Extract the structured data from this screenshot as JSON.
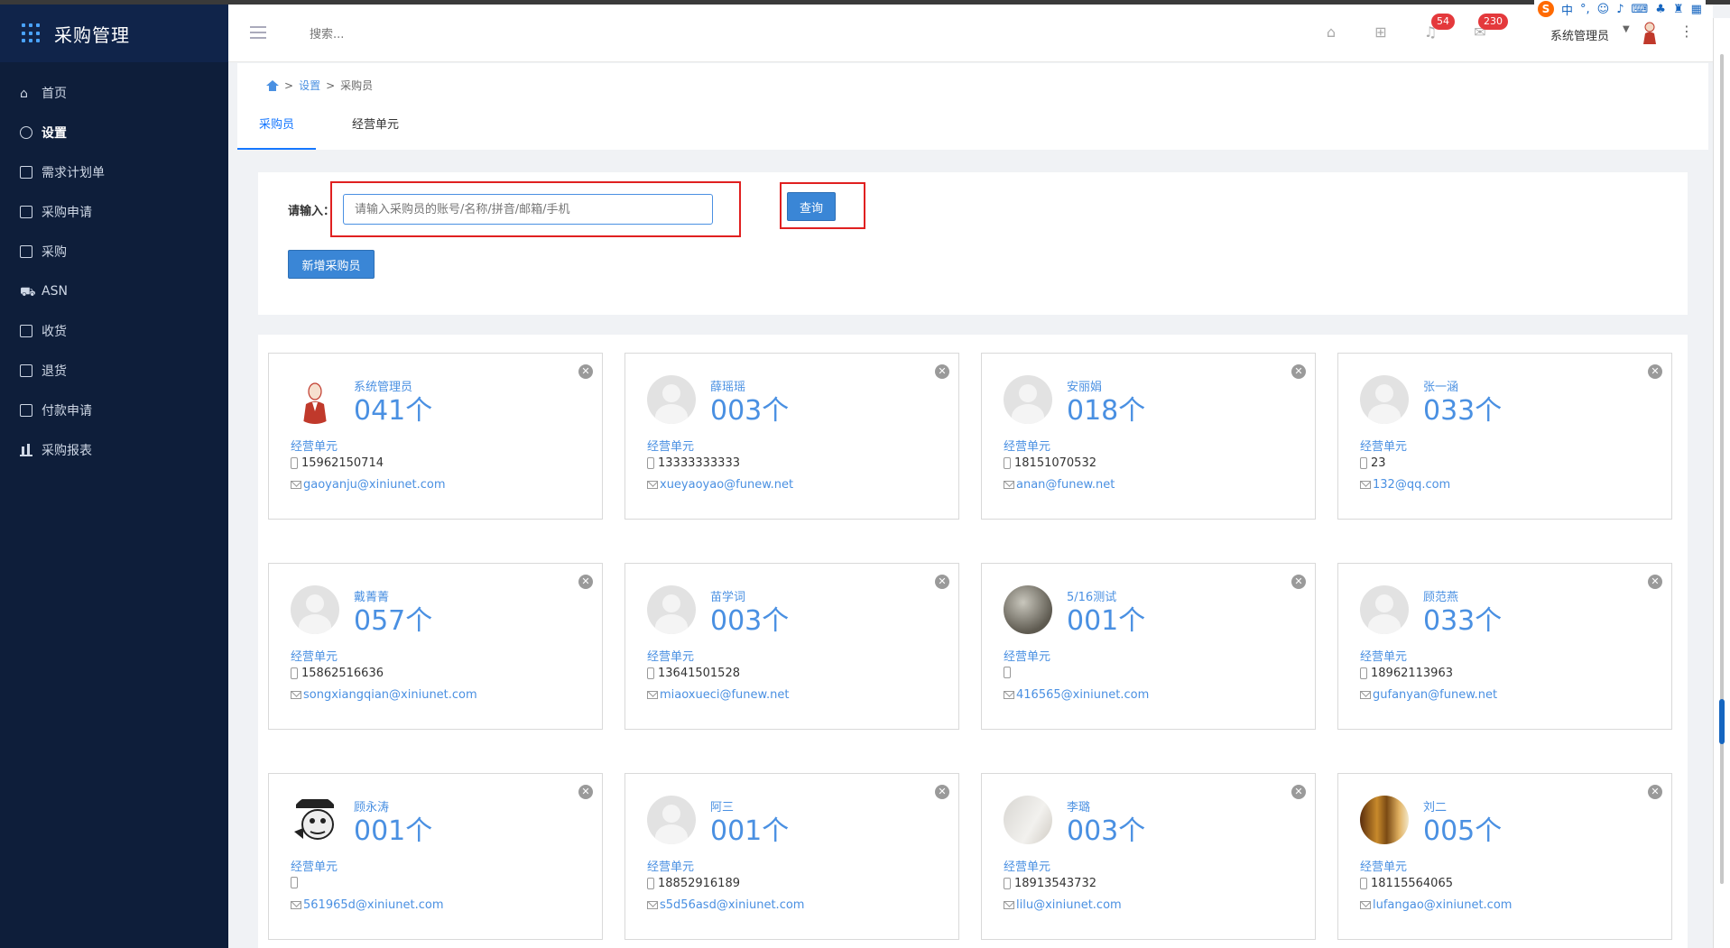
{
  "app": {
    "title": "采购管理"
  },
  "sidebar": {
    "items": [
      {
        "label": "首页",
        "icon": "home-icon"
      },
      {
        "label": "设置",
        "icon": "gear-icon"
      },
      {
        "label": "需求计划单",
        "icon": "document-icon"
      },
      {
        "label": "采购申请",
        "icon": "list-icon"
      },
      {
        "label": "采购",
        "icon": "file-icon"
      },
      {
        "label": "ASN",
        "icon": "truck-icon"
      },
      {
        "label": "收货",
        "icon": "inbox-icon"
      },
      {
        "label": "退货",
        "icon": "return-icon"
      },
      {
        "label": "付款申请",
        "icon": "payment-icon"
      },
      {
        "label": "采购报表",
        "icon": "bar-chart-icon"
      }
    ],
    "active_index": 1
  },
  "header": {
    "search_placeholder": "搜索...",
    "badges": {
      "notifications": "54",
      "messages": "230"
    },
    "user_name": "系统管理员"
  },
  "ime": {
    "lang": "中",
    "logo": "S"
  },
  "breadcrumb": {
    "level1": "设置",
    "level2": "采购员"
  },
  "tabs": [
    {
      "label": "采购员"
    },
    {
      "label": "经营单元"
    }
  ],
  "search": {
    "label": "请输入：",
    "placeholder": "请输入采购员的账号/名称/拼音/邮箱/手机",
    "query_button": "查询",
    "add_button": "新增采购员"
  },
  "cards": [
    {
      "name": "系统管理员",
      "count": "041个",
      "unit": "经营单元",
      "phone": "15962150714",
      "email": "gaoyanju@xiniunet.com"
    },
    {
      "name": "薛瑶瑶",
      "count": "003个",
      "unit": "经营单元",
      "phone": "13333333333",
      "email": "xueyaoyao@funew.net"
    },
    {
      "name": "安丽娟",
      "count": "018个",
      "unit": "经营单元",
      "phone": "18151070532",
      "email": "anan@funew.net"
    },
    {
      "name": "张一涵",
      "count": "033个",
      "unit": "经营单元",
      "phone": "23",
      "email": "132@qq.com"
    },
    {
      "name": "戴菁菁",
      "count": "057个",
      "unit": "经营单元",
      "phone": "15862516636",
      "email": "songxiangqian@xiniunet.com"
    },
    {
      "name": "苗学词",
      "count": "003个",
      "unit": "经营单元",
      "phone": "13641501528",
      "email": "miaoxueci@funew.net"
    },
    {
      "name": "5/16测试",
      "count": "001个",
      "unit": "经营单元",
      "phone": "",
      "email": "416565@xiniunet.com"
    },
    {
      "name": "顾范燕",
      "count": "033个",
      "unit": "经营单元",
      "phone": "18962113963",
      "email": "gufanyan@funew.net"
    },
    {
      "name": "顾永涛",
      "count": "001个",
      "unit": "经营单元",
      "phone": "",
      "email": "561965d@xiniunet.com"
    },
    {
      "name": "阿三",
      "count": "001个",
      "unit": "经营单元",
      "phone": "18852916189",
      "email": "s5d56asd@xiniunet.com"
    },
    {
      "name": "李璐",
      "count": "003个",
      "unit": "经营单元",
      "phone": "18913543732",
      "email": "lilu@xiniunet.com"
    },
    {
      "name": "刘二",
      "count": "005个",
      "unit": "经营单元",
      "phone": "18115564065",
      "email": "lufangao@xiniunet.com"
    }
  ]
}
